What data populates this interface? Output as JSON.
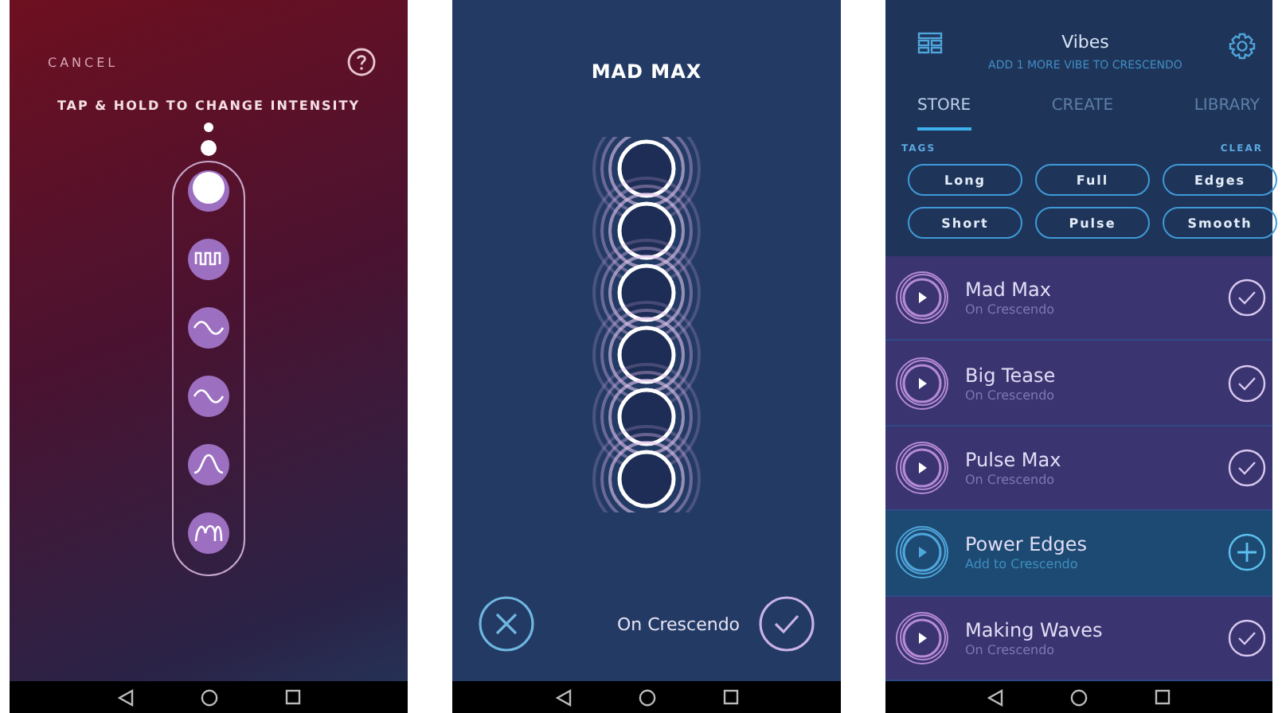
{
  "intensity_screen": {
    "cancel": "CANCEL",
    "instruction": "TAP & HOLD TO CHANGE INTENSITY",
    "patterns": [
      {
        "kind": "pulse",
        "selected": true
      },
      {
        "kind": "square",
        "selected": false
      },
      {
        "kind": "wave",
        "selected": false
      },
      {
        "kind": "wave",
        "selected": false
      },
      {
        "kind": "bump",
        "selected": false
      },
      {
        "kind": "double-bump",
        "selected": false
      }
    ]
  },
  "preview_screen": {
    "title": "MAD MAX",
    "status": "On Crescendo"
  },
  "vibes_screen": {
    "title": "Vibes",
    "subtitle": "ADD 1 MORE VIBE TO CRESCENDO",
    "tabs": [
      {
        "label": "STORE",
        "selected": true
      },
      {
        "label": "CREATE",
        "selected": false
      },
      {
        "label": "LIBRARY",
        "selected": false
      }
    ],
    "tags_label": "TAGS",
    "clear": "CLEAR",
    "tags": [
      {
        "label": "Long"
      },
      {
        "label": "Full"
      },
      {
        "label": "Edges"
      },
      {
        "label": "Short"
      },
      {
        "label": "Pulse"
      },
      {
        "label": "Smooth"
      }
    ],
    "vibes": [
      {
        "name": "Mad Max",
        "status": "On Crescendo",
        "added": true
      },
      {
        "name": "Big Tease",
        "status": "On Crescendo",
        "added": true
      },
      {
        "name": "Pulse Max",
        "status": "On Crescendo",
        "added": true
      },
      {
        "name": "Power Edges",
        "status": "Add to Crescendo",
        "added": false
      },
      {
        "name": "Making Waves",
        "status": "On Crescendo",
        "added": true
      }
    ]
  }
}
